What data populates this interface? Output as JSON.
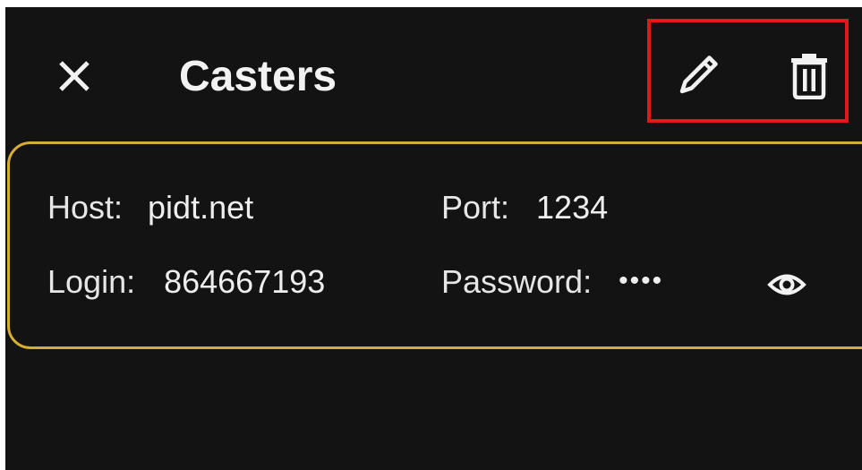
{
  "header": {
    "title": "Casters",
    "close_icon": "close-icon",
    "edit_icon": "pencil-icon",
    "delete_icon": "trash-icon"
  },
  "caster": {
    "host_label": "Host:",
    "host_value": "pidt.net",
    "port_label": "Port:",
    "port_value": "1234",
    "login_label": "Login:",
    "login_value": "864667193",
    "password_label": "Password:",
    "password_value": "••••",
    "toggle_icon": "eye-icon"
  },
  "colors": {
    "background": "#131313",
    "card_border": "#d7ad33",
    "highlight": "#e0191f",
    "text": "#eeeeee"
  }
}
